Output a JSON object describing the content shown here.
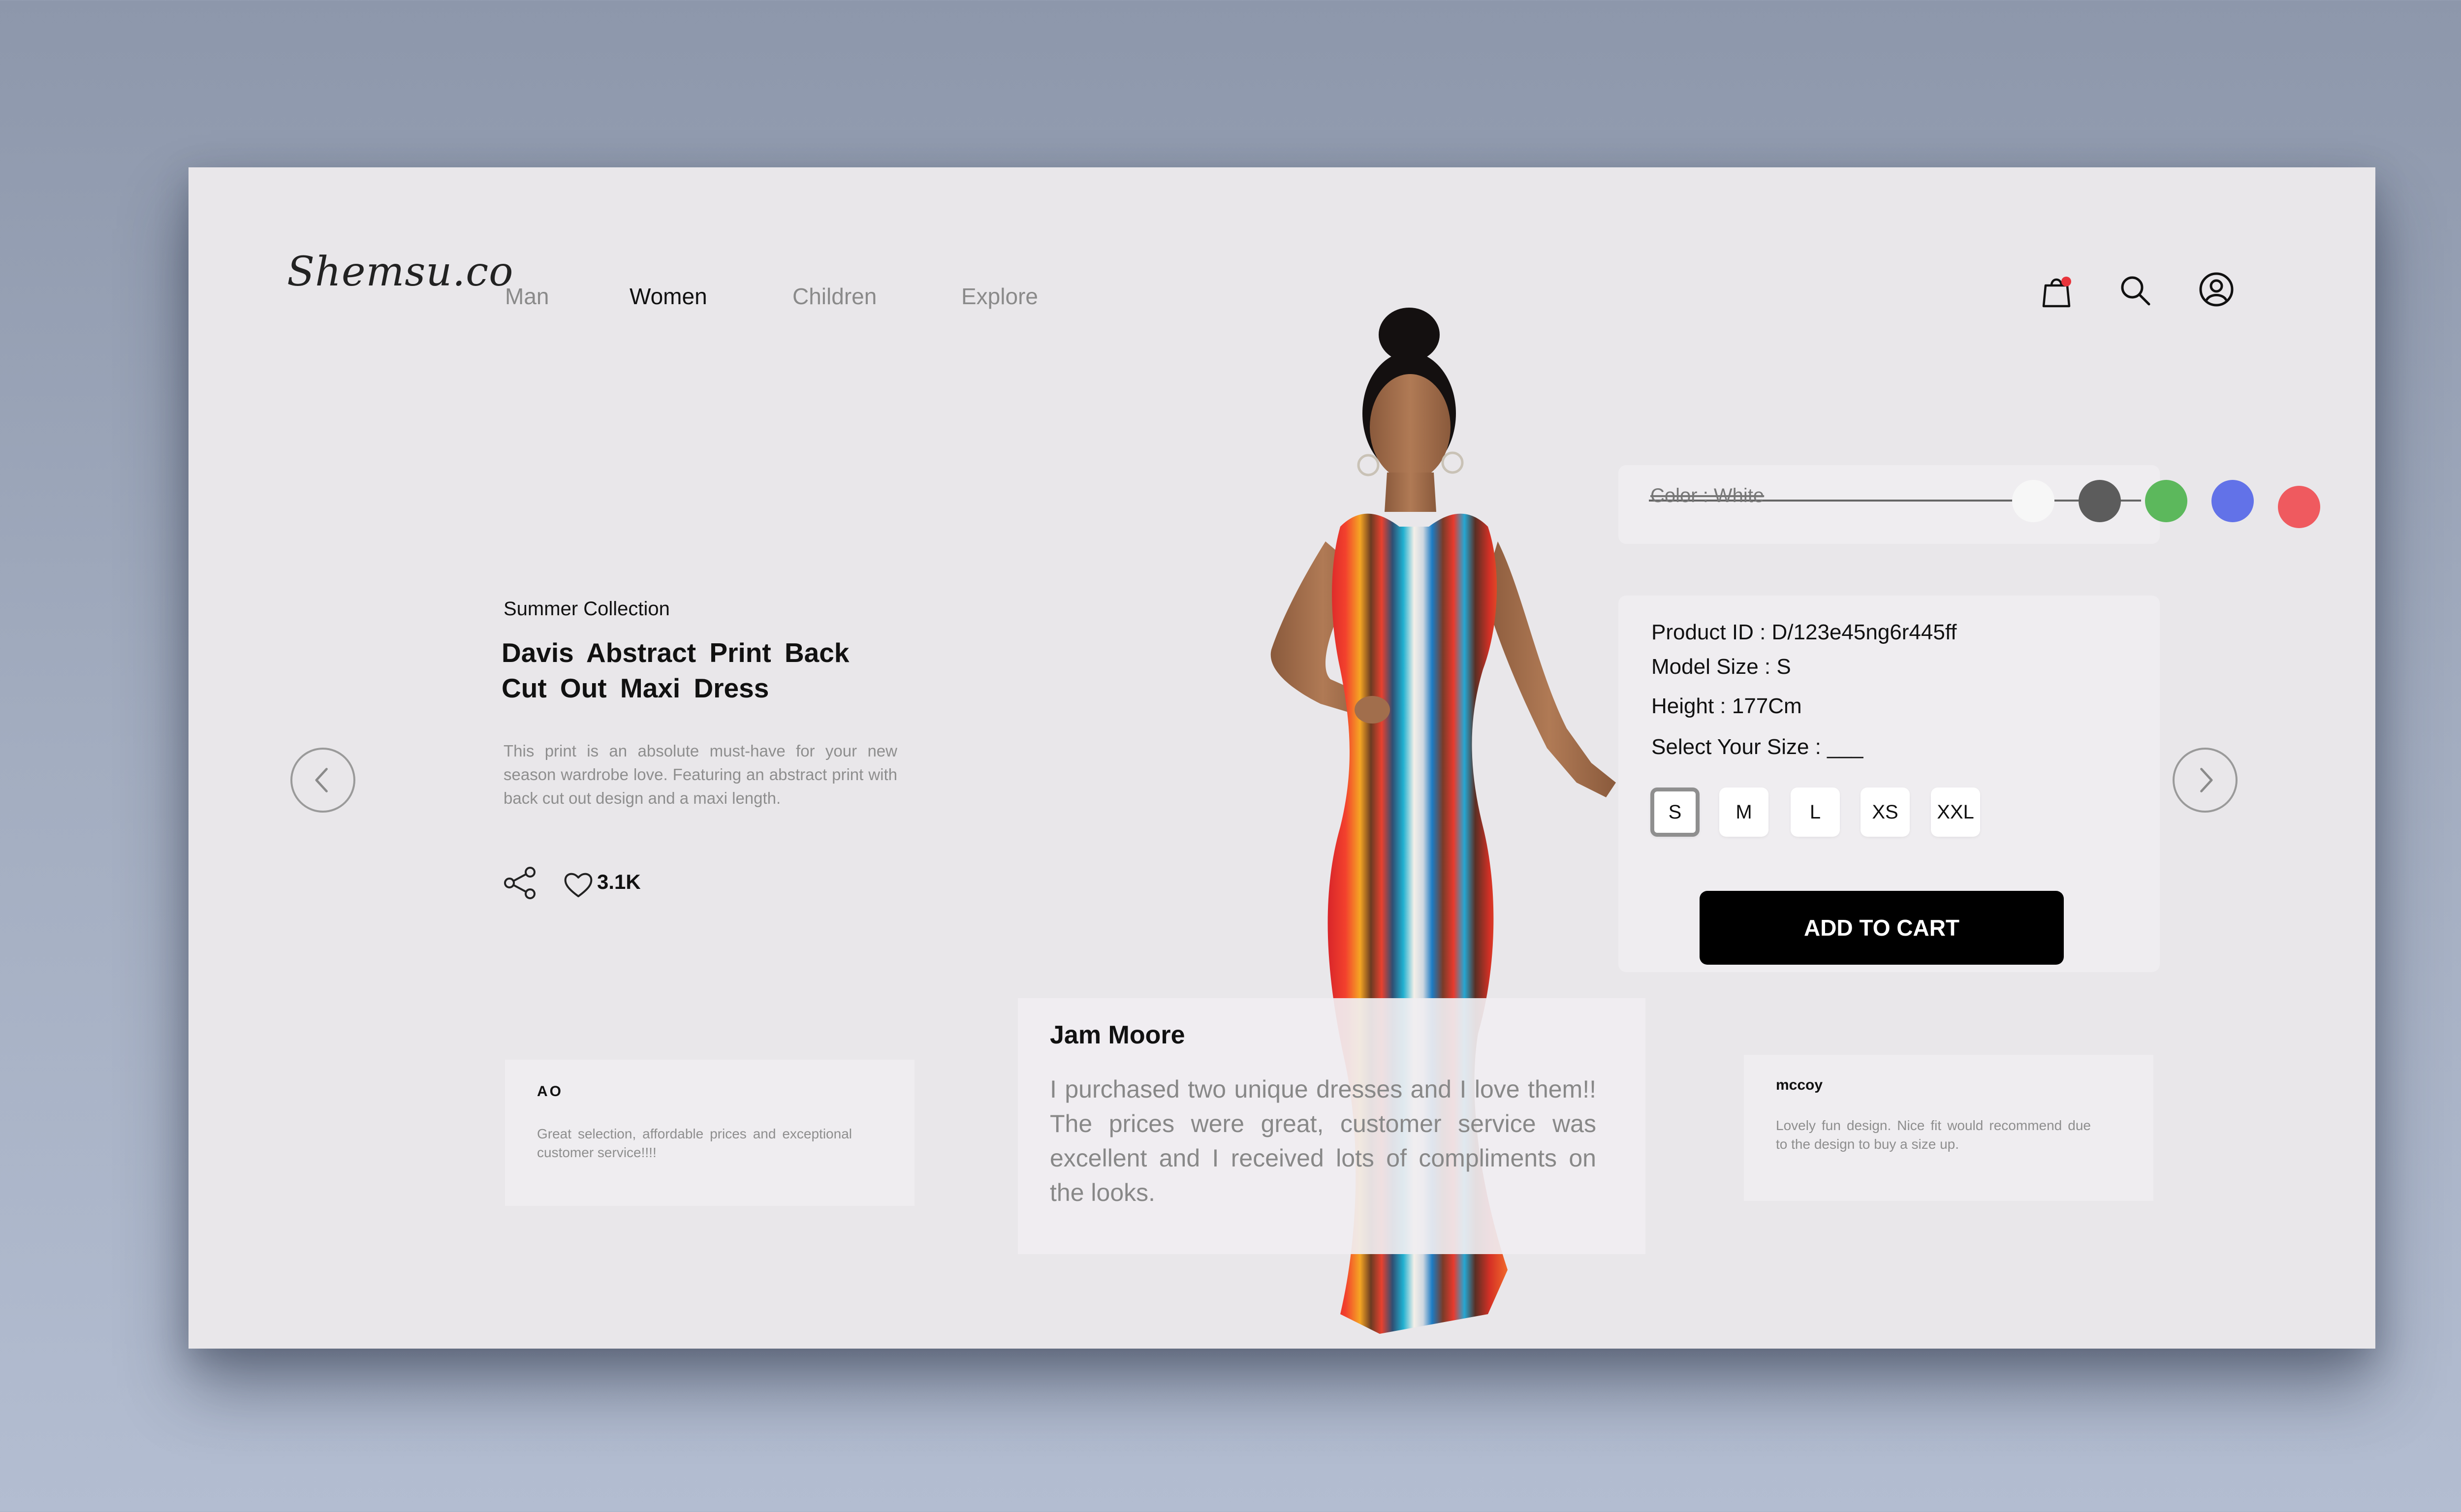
{
  "brand": {
    "logo": "Shemsu.co"
  },
  "nav": {
    "items": [
      {
        "label": "Man"
      },
      {
        "label": "Women"
      },
      {
        "label": "Children"
      },
      {
        "label": "Explore"
      }
    ]
  },
  "header_icons": [
    "shopping-bag-icon",
    "search-icon",
    "user-icon"
  ],
  "product": {
    "eyebrow": "Summer Collection",
    "title": "Davis Abstract Print Back Cut Out Maxi Dress",
    "description": "This print is an absolute must-have for your new season wardrobe love. Featuring an abstract print with back cut out design and a maxi length.",
    "likes": "3.1K"
  },
  "color": {
    "label": "Color : White",
    "swatches": [
      "#f7f7f7",
      "#5c5c5c",
      "#5cb85c",
      "#6272e8",
      "#ef5a5f"
    ]
  },
  "details": {
    "product_id": "Product ID : D/123e45ng6r445ff",
    "model_size": "Model Size : S",
    "height": "Height : 177Cm",
    "select_size": "Select Your Size : ___",
    "sizes": [
      "S",
      "M",
      "L",
      "XS",
      "XXL"
    ],
    "selected_size": "S",
    "add_to_cart": "ADD TO CART"
  },
  "reviews": {
    "main": {
      "name": "Jam Moore",
      "text": "I purchased two unique dresses and I love them!! The prices were great, customer service was excellent and I received lots of compliments on the looks."
    },
    "left": {
      "name": "AO",
      "text": "Great selection, affordable prices and exceptional customer service!!!!"
    },
    "right": {
      "name": "mccoy",
      "text": "Lovely fun design. Nice fit would recommend due to the design to buy a size up."
    }
  }
}
